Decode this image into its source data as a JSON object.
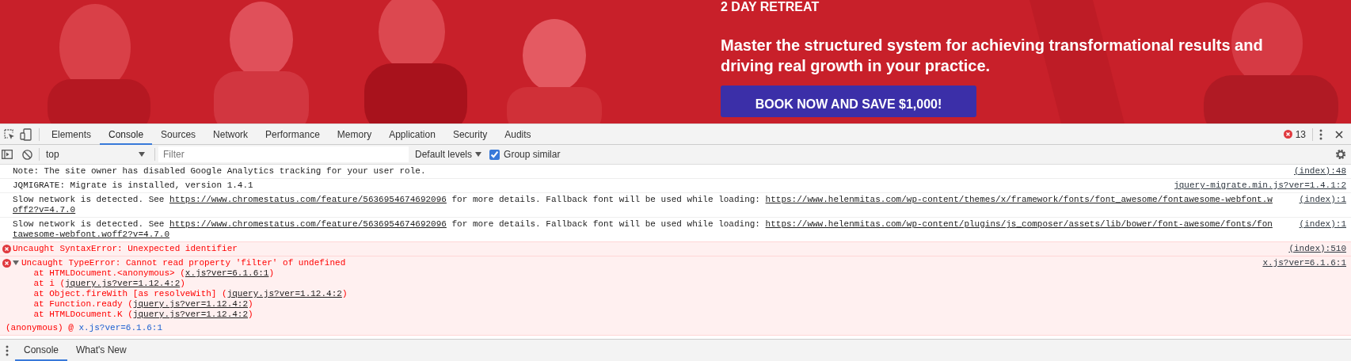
{
  "page": {
    "heading": "2 DAY RETREAT",
    "tagline": "Master the structured system for achieving transformational results and driving real growth in your practice.",
    "cta": "BOOK NOW AND SAVE $1,000!"
  },
  "devtools": {
    "tabs": [
      {
        "label": "Elements",
        "selected": false
      },
      {
        "label": "Console",
        "selected": true
      },
      {
        "label": "Sources",
        "selected": false
      },
      {
        "label": "Network",
        "selected": false
      },
      {
        "label": "Performance",
        "selected": false
      },
      {
        "label": "Memory",
        "selected": false
      },
      {
        "label": "Application",
        "selected": false
      },
      {
        "label": "Security",
        "selected": false
      },
      {
        "label": "Audits",
        "selected": false
      }
    ],
    "error_count": "13",
    "context": "top",
    "filter": {
      "placeholder": "Filter"
    },
    "levels": "Default levels",
    "group_similar": {
      "label": "Group similar",
      "checked": true
    }
  },
  "messages": [
    {
      "kind": "log",
      "source": "(index):48",
      "lines": [
        [
          {
            "kind": "text",
            "text": "Note: The site owner has disabled Google Analytics tracking for your user role."
          }
        ]
      ]
    },
    {
      "kind": "log",
      "source": "jquery-migrate.min.js?ver=1.4.1:2",
      "lines": [
        [
          {
            "kind": "text",
            "text": "JQMIGRATE: Migrate is installed, version 1.4.1"
          }
        ]
      ]
    },
    {
      "kind": "log",
      "source": "(index):1",
      "lines": [
        [
          {
            "kind": "text",
            "text": "Slow network is detected. See "
          },
          {
            "kind": "link",
            "text": "https://www.chromestatus.com/feature/5636954674692096"
          },
          {
            "kind": "text",
            "text": " for more details. Fallback font will be used while loading: "
          },
          {
            "kind": "link",
            "text": "https://www.helenmitas.com/wp-content/themes/x/framework/fonts/font_awesome/fontawesome-webfont.w"
          }
        ],
        [
          {
            "kind": "link",
            "text": "off2?v=4.7.0"
          }
        ]
      ]
    },
    {
      "kind": "log",
      "source": "(index):1",
      "lines": [
        [
          {
            "kind": "text",
            "text": "Slow network is detected. See "
          },
          {
            "kind": "link",
            "text": "https://www.chromestatus.com/feature/5636954674692096"
          },
          {
            "kind": "text",
            "text": " for more details. Fallback font will be used while loading: "
          },
          {
            "kind": "link",
            "text": "https://www.helenmitas.com/wp-content/plugins/js_composer/assets/lib/bower/font-awesome/fonts/fon"
          }
        ],
        [
          {
            "kind": "link",
            "text": "tawesome-webfont.woff2?v=4.7.0"
          }
        ]
      ]
    },
    {
      "kind": "error",
      "source": "(index):510",
      "lines": [
        [
          {
            "kind": "text",
            "text": "Uncaught SyntaxError: Unexpected identifier"
          }
        ]
      ]
    },
    {
      "kind": "error",
      "source": "x.js?ver=6.1.6:1",
      "expanded": true,
      "lines": [
        [
          {
            "kind": "text",
            "text": "Uncaught TypeError: Cannot read property 'filter' of undefined"
          }
        ],
        [
          {
            "kind": "text",
            "text": "    at HTMLDocument.<anonymous> ("
          },
          {
            "kind": "link",
            "text": "x.js?ver=6.1.6:1"
          },
          {
            "kind": "text",
            "text": ")"
          }
        ],
        [
          {
            "kind": "text",
            "text": "    at i ("
          },
          {
            "kind": "link",
            "text": "jquery.js?ver=1.12.4:2"
          },
          {
            "kind": "text",
            "text": ")"
          }
        ],
        [
          {
            "kind": "text",
            "text": "    at Object.fireWith [as resolveWith] ("
          },
          {
            "kind": "link",
            "text": "jquery.js?ver=1.12.4:2"
          },
          {
            "kind": "text",
            "text": ")"
          }
        ],
        [
          {
            "kind": "text",
            "text": "    at Function.ready ("
          },
          {
            "kind": "link",
            "text": "jquery.js?ver=1.12.4:2"
          },
          {
            "kind": "text",
            "text": ")"
          }
        ],
        [
          {
            "kind": "text",
            "text": "    at HTMLDocument.K ("
          },
          {
            "kind": "link",
            "text": "jquery.js?ver=1.12.4:2"
          },
          {
            "kind": "text",
            "text": ")"
          }
        ]
      ],
      "call_site": {
        "text": "(anonymous) @ ",
        "link": "x.js?ver=6.1.6:1"
      }
    }
  ],
  "drawer_tabs": [
    {
      "label": "Console",
      "selected": true
    },
    {
      "label": "What's New",
      "selected": false
    }
  ]
}
